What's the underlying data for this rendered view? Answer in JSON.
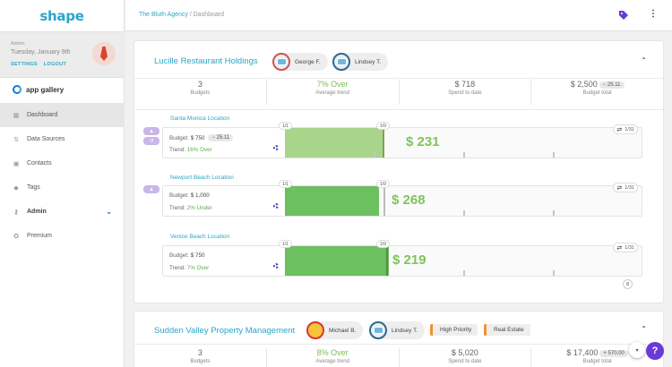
{
  "app": {
    "logo": "shape"
  },
  "user": {
    "role": "Admin",
    "date": "Tuesday, January 9th",
    "settings": "SETTINGS",
    "logout": "LOGOUT"
  },
  "gallery": {
    "label": "app gallery"
  },
  "nav": [
    {
      "label": "Dashboard",
      "icon": "dashboard-icon",
      "active": true
    },
    {
      "label": "Data Sources",
      "icon": "sort-icon"
    },
    {
      "label": "Contacts",
      "icon": "contacts-icon"
    },
    {
      "label": "Tags",
      "icon": "tag-icon"
    },
    {
      "label": "Admin",
      "icon": "key-icon"
    },
    {
      "label": "Premium",
      "icon": "premium-icon"
    }
  ],
  "header": {
    "crumb_org": "The Bluth Agency",
    "crumb_sep": "/",
    "crumb_page": "Dashboard"
  },
  "card1": {
    "title": "Lucille Restaurant Holdings",
    "members": [
      "George F.",
      "Lindsey T."
    ],
    "stats": [
      {
        "value": "3",
        "label": "Budgets"
      },
      {
        "value": "7% Over",
        "label": "Average trend"
      },
      {
        "value": "$ 718",
        "label": "Spend to date"
      },
      {
        "value": "$ 2,500",
        "pill": "− 25.11",
        "label": "Budget total"
      }
    ],
    "locations": [
      {
        "name": "Santa Monica Location",
        "budget_label": "Budget:",
        "budget": "$ 750",
        "pill": "− 25.11",
        "trend_label": "Trend:",
        "trend": "16% Over",
        "amount": "$ 231",
        "b1": "1/1",
        "b2": "1/9",
        "cycle": "1/31",
        "fill_pct": 0.21
      },
      {
        "name": "Newport Beach Location",
        "budget_label": "Budget:",
        "budget": "$ 1,000",
        "trend_label": "Trend:",
        "trend": "2% Under",
        "amount": "$ 268",
        "b1": "1/1",
        "b2": "1/9",
        "cycle": "1/31",
        "fill_pct": 0.19
      },
      {
        "name": "Venice Beach Location",
        "budget_label": "Budget:",
        "budget": "$ 750",
        "trend_label": "Trend:",
        "trend": "7% Over",
        "amount": "$ 219",
        "b1": "1/1",
        "b2": "1/9",
        "cycle": "1/31",
        "fill_pct": 0.2
      }
    ],
    "count": "8"
  },
  "card2": {
    "title": "Sudden Valley Property Management",
    "members": [
      "Michael B.",
      "Lindsey T."
    ],
    "tags": [
      "High Priority",
      "Real Estate"
    ],
    "stats": [
      {
        "value": "3",
        "label": "Budgets"
      },
      {
        "value": "8% Over",
        "label": "Average trend"
      },
      {
        "value": "$ 5,020",
        "label": "Spend to date"
      },
      {
        "value": "$ 17,400",
        "pill": "+ 570.00",
        "label": "Budget total"
      }
    ]
  },
  "colors": {
    "accent": "#2aa6c8",
    "green": "#6cc05f",
    "help": "#6a3ad6"
  }
}
